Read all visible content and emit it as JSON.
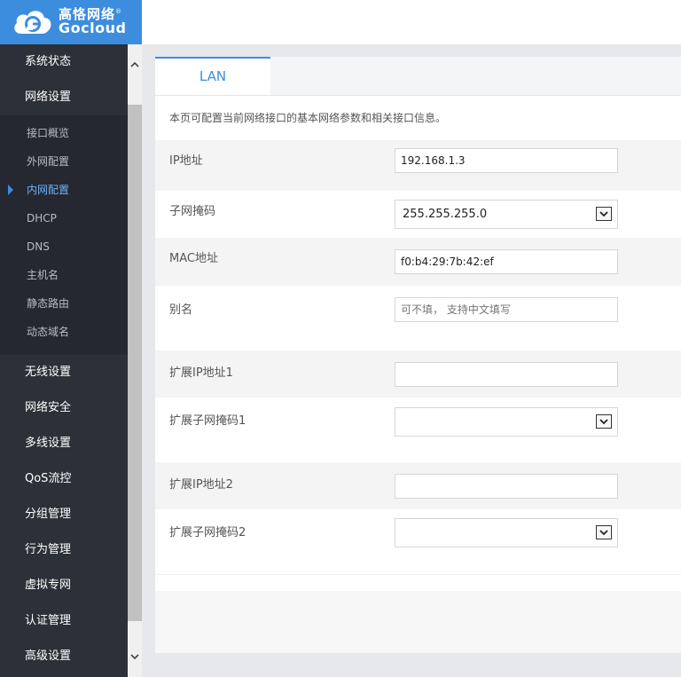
{
  "brand": {
    "cn": "高恪网络",
    "en": "Gocloud",
    "reg": "®"
  },
  "sidebar": {
    "top_items": [
      {
        "label": "系统状态"
      },
      {
        "label": "网络设置"
      }
    ],
    "submenu": [
      {
        "label": "接口概览"
      },
      {
        "label": "外网配置"
      },
      {
        "label": "内网配置",
        "active": true
      },
      {
        "label": "DHCP"
      },
      {
        "label": "DNS"
      },
      {
        "label": "主机名"
      },
      {
        "label": "静态路由"
      },
      {
        "label": "动态域名"
      }
    ],
    "bottom_items": [
      {
        "label": "无线设置"
      },
      {
        "label": "网络安全"
      },
      {
        "label": "多线设置"
      },
      {
        "label": "QoS流控"
      },
      {
        "label": "分组管理"
      },
      {
        "label": "行为管理"
      },
      {
        "label": "虚拟专网"
      },
      {
        "label": "认证管理"
      },
      {
        "label": "高级设置"
      }
    ]
  },
  "tabs": [
    {
      "label": "LAN"
    }
  ],
  "description": "本页可配置当前网络接口的基本网络参数和相关接口信息。",
  "form": {
    "ip_label": "IP地址",
    "ip_value": "192.168.1.3",
    "mask_label": "子网掩码",
    "mask_value": "255.255.255.0",
    "mac_label": "MAC地址",
    "mac_value": "f0:b4:29:7b:42:ef",
    "alias_label": "别名",
    "alias_placeholder": "可不填， 支持中文填写",
    "ext_ip1_label": "扩展IP地址1",
    "ext_ip1_value": "",
    "ext_mask1_label": "扩展子网掩码1",
    "ext_mask1_value": "",
    "ext_ip2_label": "扩展IP地址2",
    "ext_ip2_value": "",
    "ext_mask2_label": "扩展子网掩码2",
    "ext_mask2_value": ""
  },
  "colors": {
    "accent": "#3c8dde",
    "sidebar": "#2c3038",
    "submenu_bg": "#252830"
  },
  "icons": {
    "logo": "cloud-logo-icon",
    "dropdown": "chevron-down-icon",
    "scroll_up": "chevron-up-icon",
    "scroll_down": "chevron-down-icon",
    "active_marker": "triangle-right-icon"
  }
}
